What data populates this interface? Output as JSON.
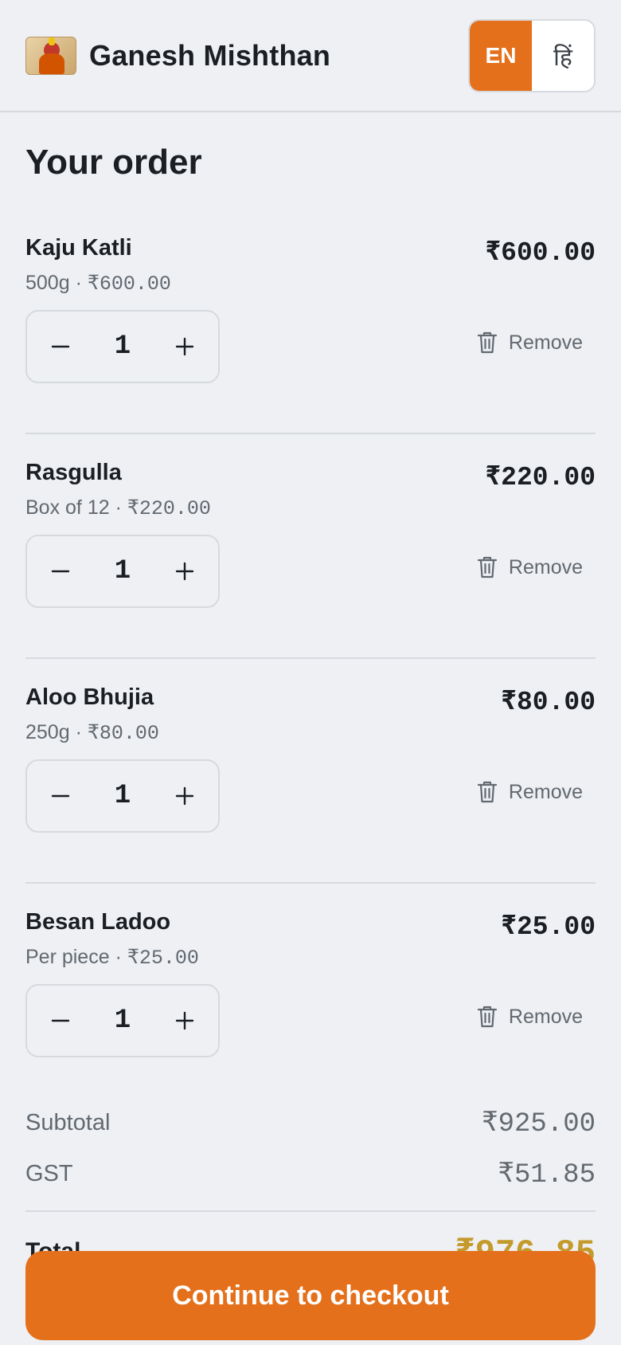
{
  "header": {
    "brand": "Ganesh Mishthan",
    "lang_en": "EN",
    "lang_hi": "हिं"
  },
  "page_title": "Your order",
  "items": [
    {
      "name": "Kaju Katli",
      "price": "₹600.00",
      "size": "500g",
      "sep": " · ",
      "unit_price": "₹600.00",
      "qty": "1",
      "remove": "Remove"
    },
    {
      "name": "Rasgulla",
      "price": "₹220.00",
      "size": "Box of 12",
      "sep": " · ",
      "unit_price": "₹220.00",
      "qty": "1",
      "remove": "Remove"
    },
    {
      "name": "Aloo Bhujia",
      "price": "₹80.00",
      "size": "250g",
      "sep": " · ",
      "unit_price": "₹80.00",
      "qty": "1",
      "remove": "Remove"
    },
    {
      "name": "Besan Ladoo",
      "price": "₹25.00",
      "size": "Per piece",
      "sep": " · ",
      "unit_price": "₹25.00",
      "qty": "1",
      "remove": "Remove"
    }
  ],
  "summary": {
    "subtotal_label": "Subtotal",
    "subtotal_value": "₹925.00",
    "gst_label": "GST",
    "gst_value": "₹51.85",
    "total_label": "Total",
    "total_value": "₹976.85"
  },
  "checkout_label": "Continue to checkout",
  "colors": {
    "accent": "#e4701b",
    "total": "#c49a2c",
    "background": "#eef0f3"
  }
}
